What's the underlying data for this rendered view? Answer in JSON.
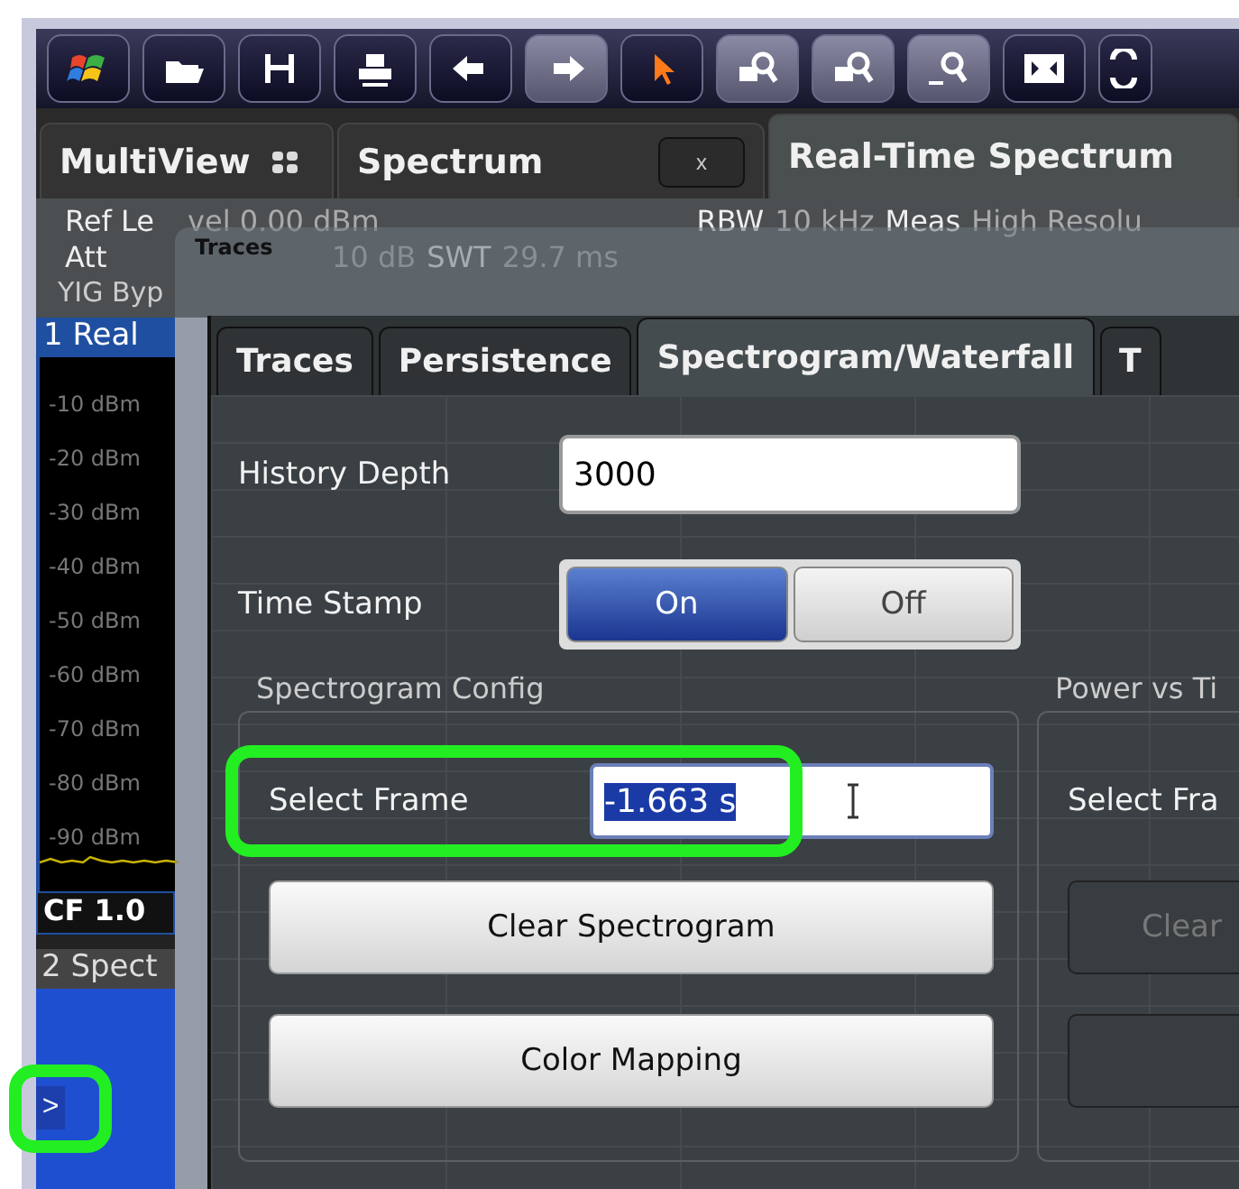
{
  "tabs": [
    {
      "label": "MultiView",
      "selected": false,
      "kind": "multiview"
    },
    {
      "label": "Spectrum",
      "selected": false,
      "kind": "closable",
      "close": "x"
    },
    {
      "label": "Real-Time Spectrum",
      "selected": true,
      "kind": "plain"
    }
  ],
  "info": {
    "ref_level_label": "Ref Le",
    "ref_level_value": "vel 0.00 dBm",
    "att_label": "Att",
    "att_value": "10 dB",
    "swt_label": "SWT",
    "swt_value": "29.7 ms",
    "rbw_label": "RBW",
    "rbw_value": "10 kHz",
    "meas_label": "Meas",
    "meas_value": "High Resolu",
    "yig": "YIG Byp"
  },
  "window_1": {
    "title": "1 Real",
    "y_labels": [
      "-10 dBm",
      "-20 dBm",
      "-30 dBm",
      "-40 dBm",
      "-50 dBm",
      "-60 dBm",
      "-70 dBm",
      "-80 dBm",
      "-90 dBm"
    ],
    "cf": "CF 1.0"
  },
  "window_2": {
    "title": "2 Spect",
    "expand": ">"
  },
  "dialog": {
    "title": "Traces",
    "tabs": [
      {
        "label": "Traces",
        "selected": false
      },
      {
        "label": "Persistence",
        "selected": false
      },
      {
        "label": "Spectrogram/Waterfall",
        "selected": true
      },
      {
        "label": "T",
        "selected": false
      }
    ],
    "history_depth": {
      "label": "History Depth",
      "value": "3000"
    },
    "time_stamp": {
      "label": "Time Stamp",
      "options": [
        {
          "label": "On",
          "selected": true
        },
        {
          "label": "Off",
          "selected": false
        }
      ]
    },
    "spectrogram_config": {
      "title": "Spectrogram Config",
      "select_frame": {
        "label": "Select Frame",
        "value": "-1.663 s",
        "highlighted": true
      },
      "buttons": [
        {
          "label": "Clear Spectrogram",
          "disabled": false
        },
        {
          "label": "Color Mapping",
          "disabled": false
        }
      ]
    },
    "power_vs_time": {
      "title": "Power vs Ti",
      "select_frame": {
        "label": "Select Fra"
      },
      "buttons": [
        {
          "label": "Clear",
          "disabled": true
        },
        {
          "disabled": true
        }
      ]
    }
  },
  "annotations": {
    "expand_highlight": true
  }
}
